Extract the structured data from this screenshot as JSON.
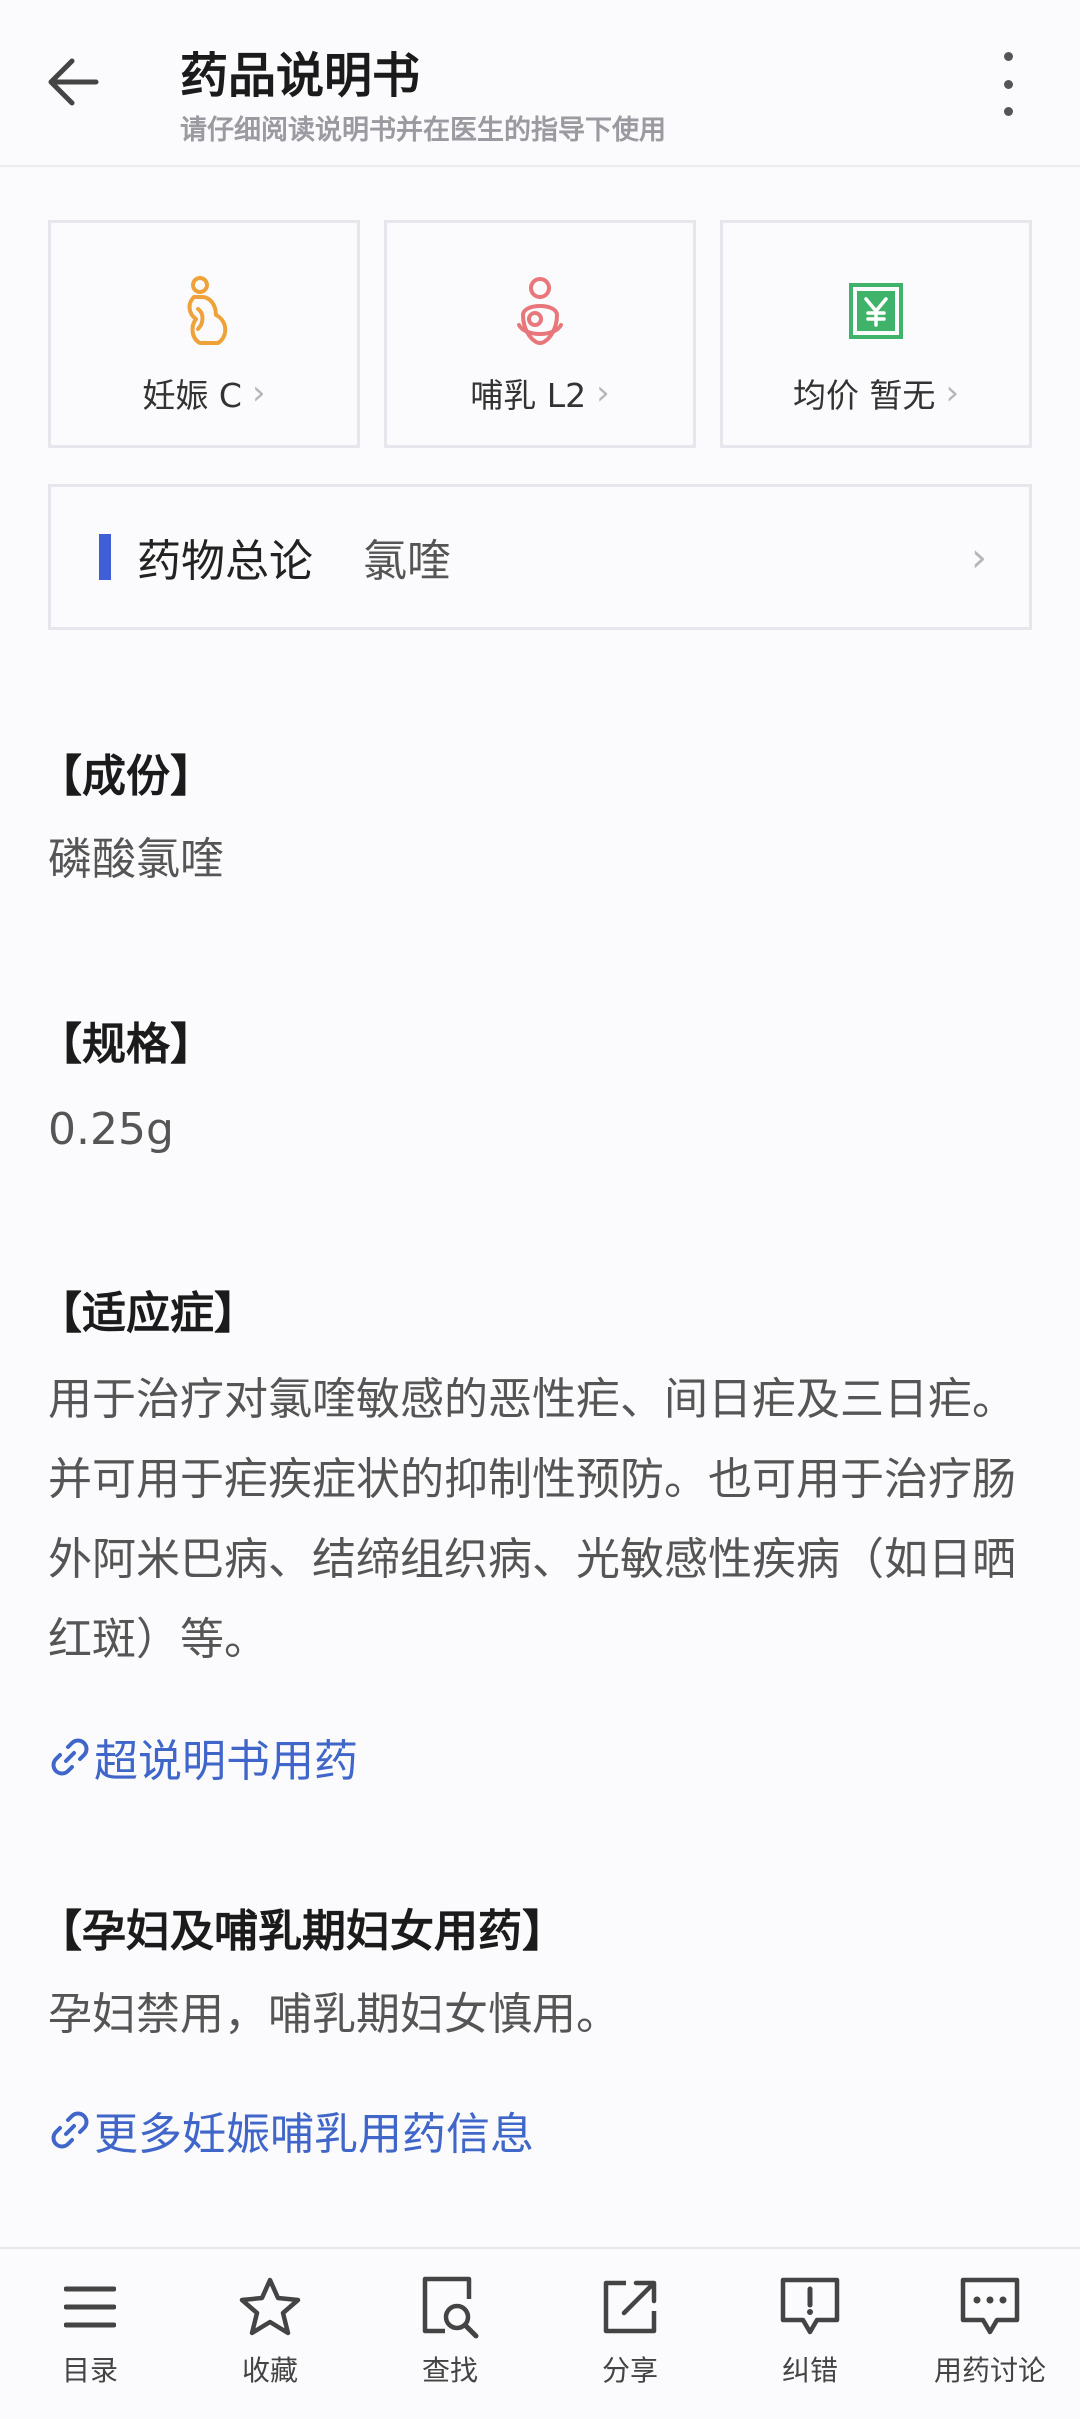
{
  "header": {
    "title": "药品说明书",
    "subtitle": "请仔细阅读说明书并在医生的指导下使用"
  },
  "cards": [
    {
      "label": "妊娠 C",
      "icon": "pregnancy-icon",
      "color": "#f0a23a"
    },
    {
      "label": "哺乳 L2",
      "icon": "breastfeeding-icon",
      "color": "#e8767a"
    },
    {
      "label": "均价 暂无",
      "icon": "price-yen-icon",
      "color": "#3fb36a"
    }
  ],
  "summary": {
    "label": "药物总论",
    "value": "氯喹"
  },
  "sections": [
    {
      "title": "【成份】",
      "text": "磷酸氯喹"
    },
    {
      "title": "【规格】",
      "text": "0.25g"
    },
    {
      "title": "【适应症】",
      "text": "用于治疗对氯喹敏感的恶性疟、间日疟及三日疟。并可用于疟疾症状的抑制性预防。也可用于治疗肠外阿米巴病、结缔组织病、光敏感性疾病（如日晒红斑）等。"
    },
    {
      "title": "【孕妇及哺乳期妇女用药】",
      "text": "孕妇禁用，哺乳期妇女慎用。"
    }
  ],
  "links": {
    "off_label": "超说明书用药",
    "more_pregnancy": "更多妊娠哺乳用药信息"
  },
  "bottom_nav": [
    {
      "label": "目录",
      "icon": "menu-list-icon"
    },
    {
      "label": "收藏",
      "icon": "star-icon"
    },
    {
      "label": "查找",
      "icon": "search-doc-icon"
    },
    {
      "label": "分享",
      "icon": "share-icon"
    },
    {
      "label": "纠错",
      "icon": "report-error-icon"
    },
    {
      "label": "用药讨论",
      "icon": "discussion-icon"
    }
  ],
  "colors": {
    "accent": "#3e5fd6",
    "link": "#3f66c8"
  }
}
